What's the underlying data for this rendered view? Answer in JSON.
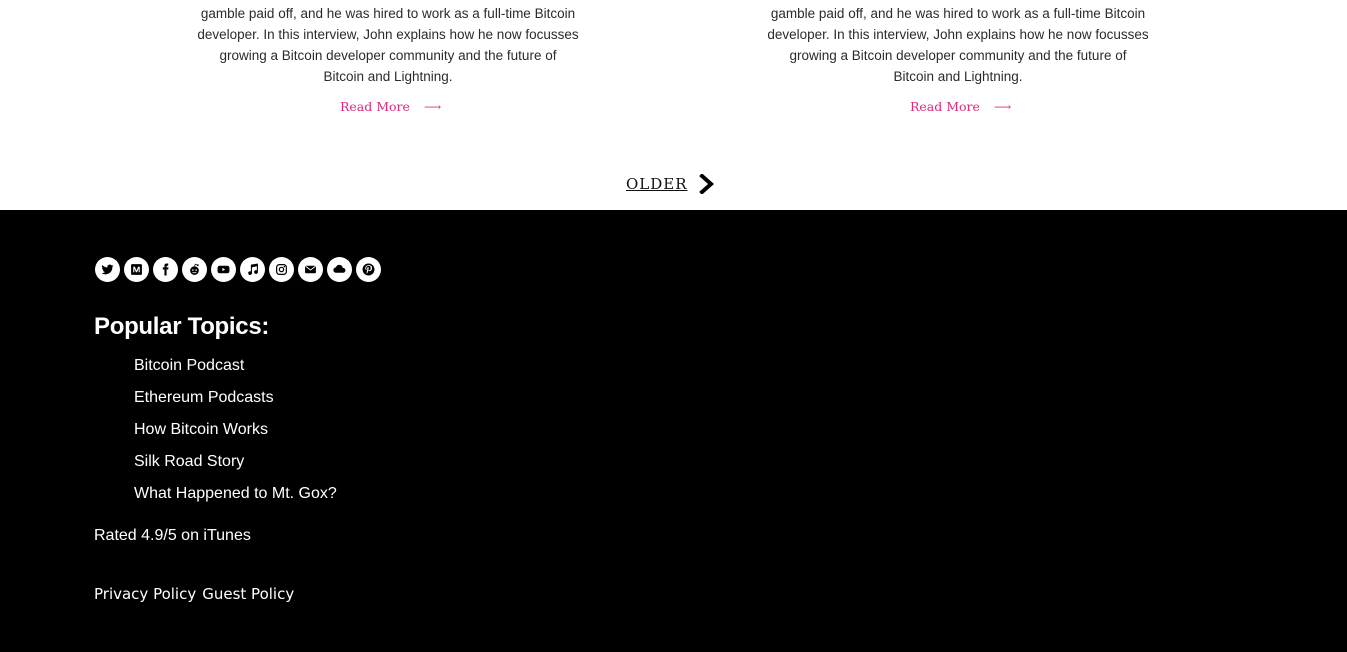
{
  "posts": [
    {
      "excerpt_lines": [
        "gamble paid off, and he was hired to work as a full-time Bitcoin",
        "developer. In this interview, John explains how he now focusses",
        "growing a Bitcoin developer community and the future of",
        "Bitcoin and Lightning."
      ],
      "read_more": "Read More"
    },
    {
      "excerpt_lines": [
        "gamble paid off, and he was hired to work as a full-time Bitcoin",
        "developer. In this interview, John explains how he now focusses",
        "growing a Bitcoin developer community and the future of",
        "Bitcoin and Lightning."
      ],
      "read_more": "Read More"
    }
  ],
  "pagination": {
    "older_label": "OLDER"
  },
  "footer": {
    "social_icons": [
      "twitter-icon",
      "medium-icon",
      "facebook-icon",
      "reddit-icon",
      "youtube-icon",
      "music-icon",
      "instagram-icon",
      "email-icon",
      "cloud-icon",
      "pinterest-icon"
    ],
    "topics_title": "Popular Topics:",
    "topics": [
      "Bitcoin Podcast",
      "Ethereum Podcasts",
      "How Bitcoin Works",
      "Silk Road Story",
      "What Happened to Mt. Gox?"
    ],
    "rating": "Rated 4.9/5 on iTunes",
    "privacy_policy": "Privacy Policy",
    "guest_policy": "Guest Policy"
  },
  "colors": {
    "accent": "#e0287d",
    "footer_bg": "#000000",
    "text": "#2b2b2b"
  }
}
